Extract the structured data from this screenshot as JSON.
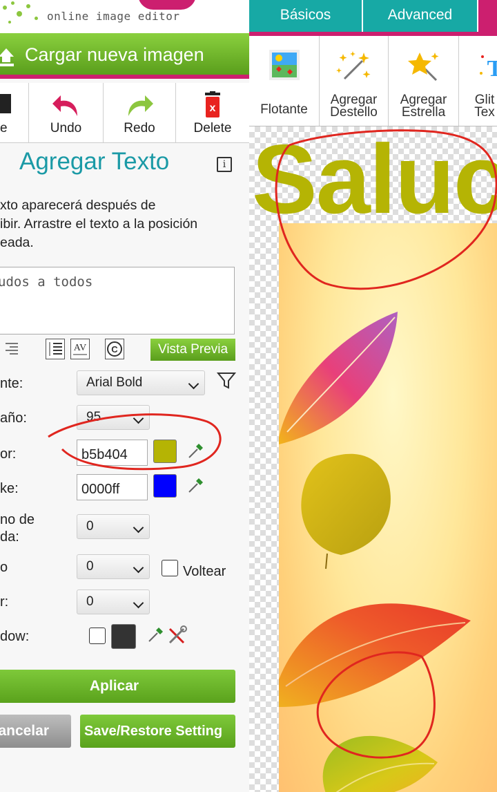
{
  "app": {
    "logo_text": "online image editor"
  },
  "upload_button": {
    "label": "Cargar nueva imagen"
  },
  "toolbar": {
    "items": [
      {
        "label": "e"
      },
      {
        "label": "Undo"
      },
      {
        "label": "Redo"
      },
      {
        "label": "Delete"
      }
    ]
  },
  "panel": {
    "title": "Agregar Texto",
    "info": "i",
    "help_lines": [
      "xto aparecerá después de",
      "ibir. Arrastre el texto a la posición",
      "eada."
    ],
    "text_value": "udos a todos",
    "preview_label": "Vista Previa"
  },
  "settings": {
    "font": {
      "label": "nte:",
      "value": "Arial Bold"
    },
    "size": {
      "label": "año:",
      "value": "95"
    },
    "color": {
      "label": "or:",
      "value": "b5b404",
      "swatch": "#b5b404"
    },
    "stroke": {
      "label": "ke:",
      "value": "0000ff",
      "swatch": "#0000ff"
    },
    "stroke_width": {
      "label_line1": "no de",
      "label_line2": "da:",
      "value": "0"
    },
    "rotation": {
      "label": "",
      "value": "0",
      "flip_label": "Voltear"
    },
    "curve": {
      "label": "r:",
      "value": "0"
    },
    "shadow": {
      "label": "dow:"
    }
  },
  "actions": {
    "apply": "Aplicar",
    "cancel": "ancelar",
    "save_restore": "Save/Restore Setting"
  },
  "tabs": [
    {
      "label": "Básicos"
    },
    {
      "label": "Advanced"
    }
  ],
  "tools": [
    {
      "label_line1": "",
      "label_line2": "Flotante"
    },
    {
      "label_line1": "Agregar",
      "label_line2": "Destello"
    },
    {
      "label_line1": "Agregar",
      "label_line2": "Estrella"
    },
    {
      "label_line1": "Glit",
      "label_line2": "Tex"
    }
  ],
  "canvas": {
    "overlay_text": "Saluc",
    "text_color": "#b5b404",
    "annotation_color": "#e0261f"
  }
}
